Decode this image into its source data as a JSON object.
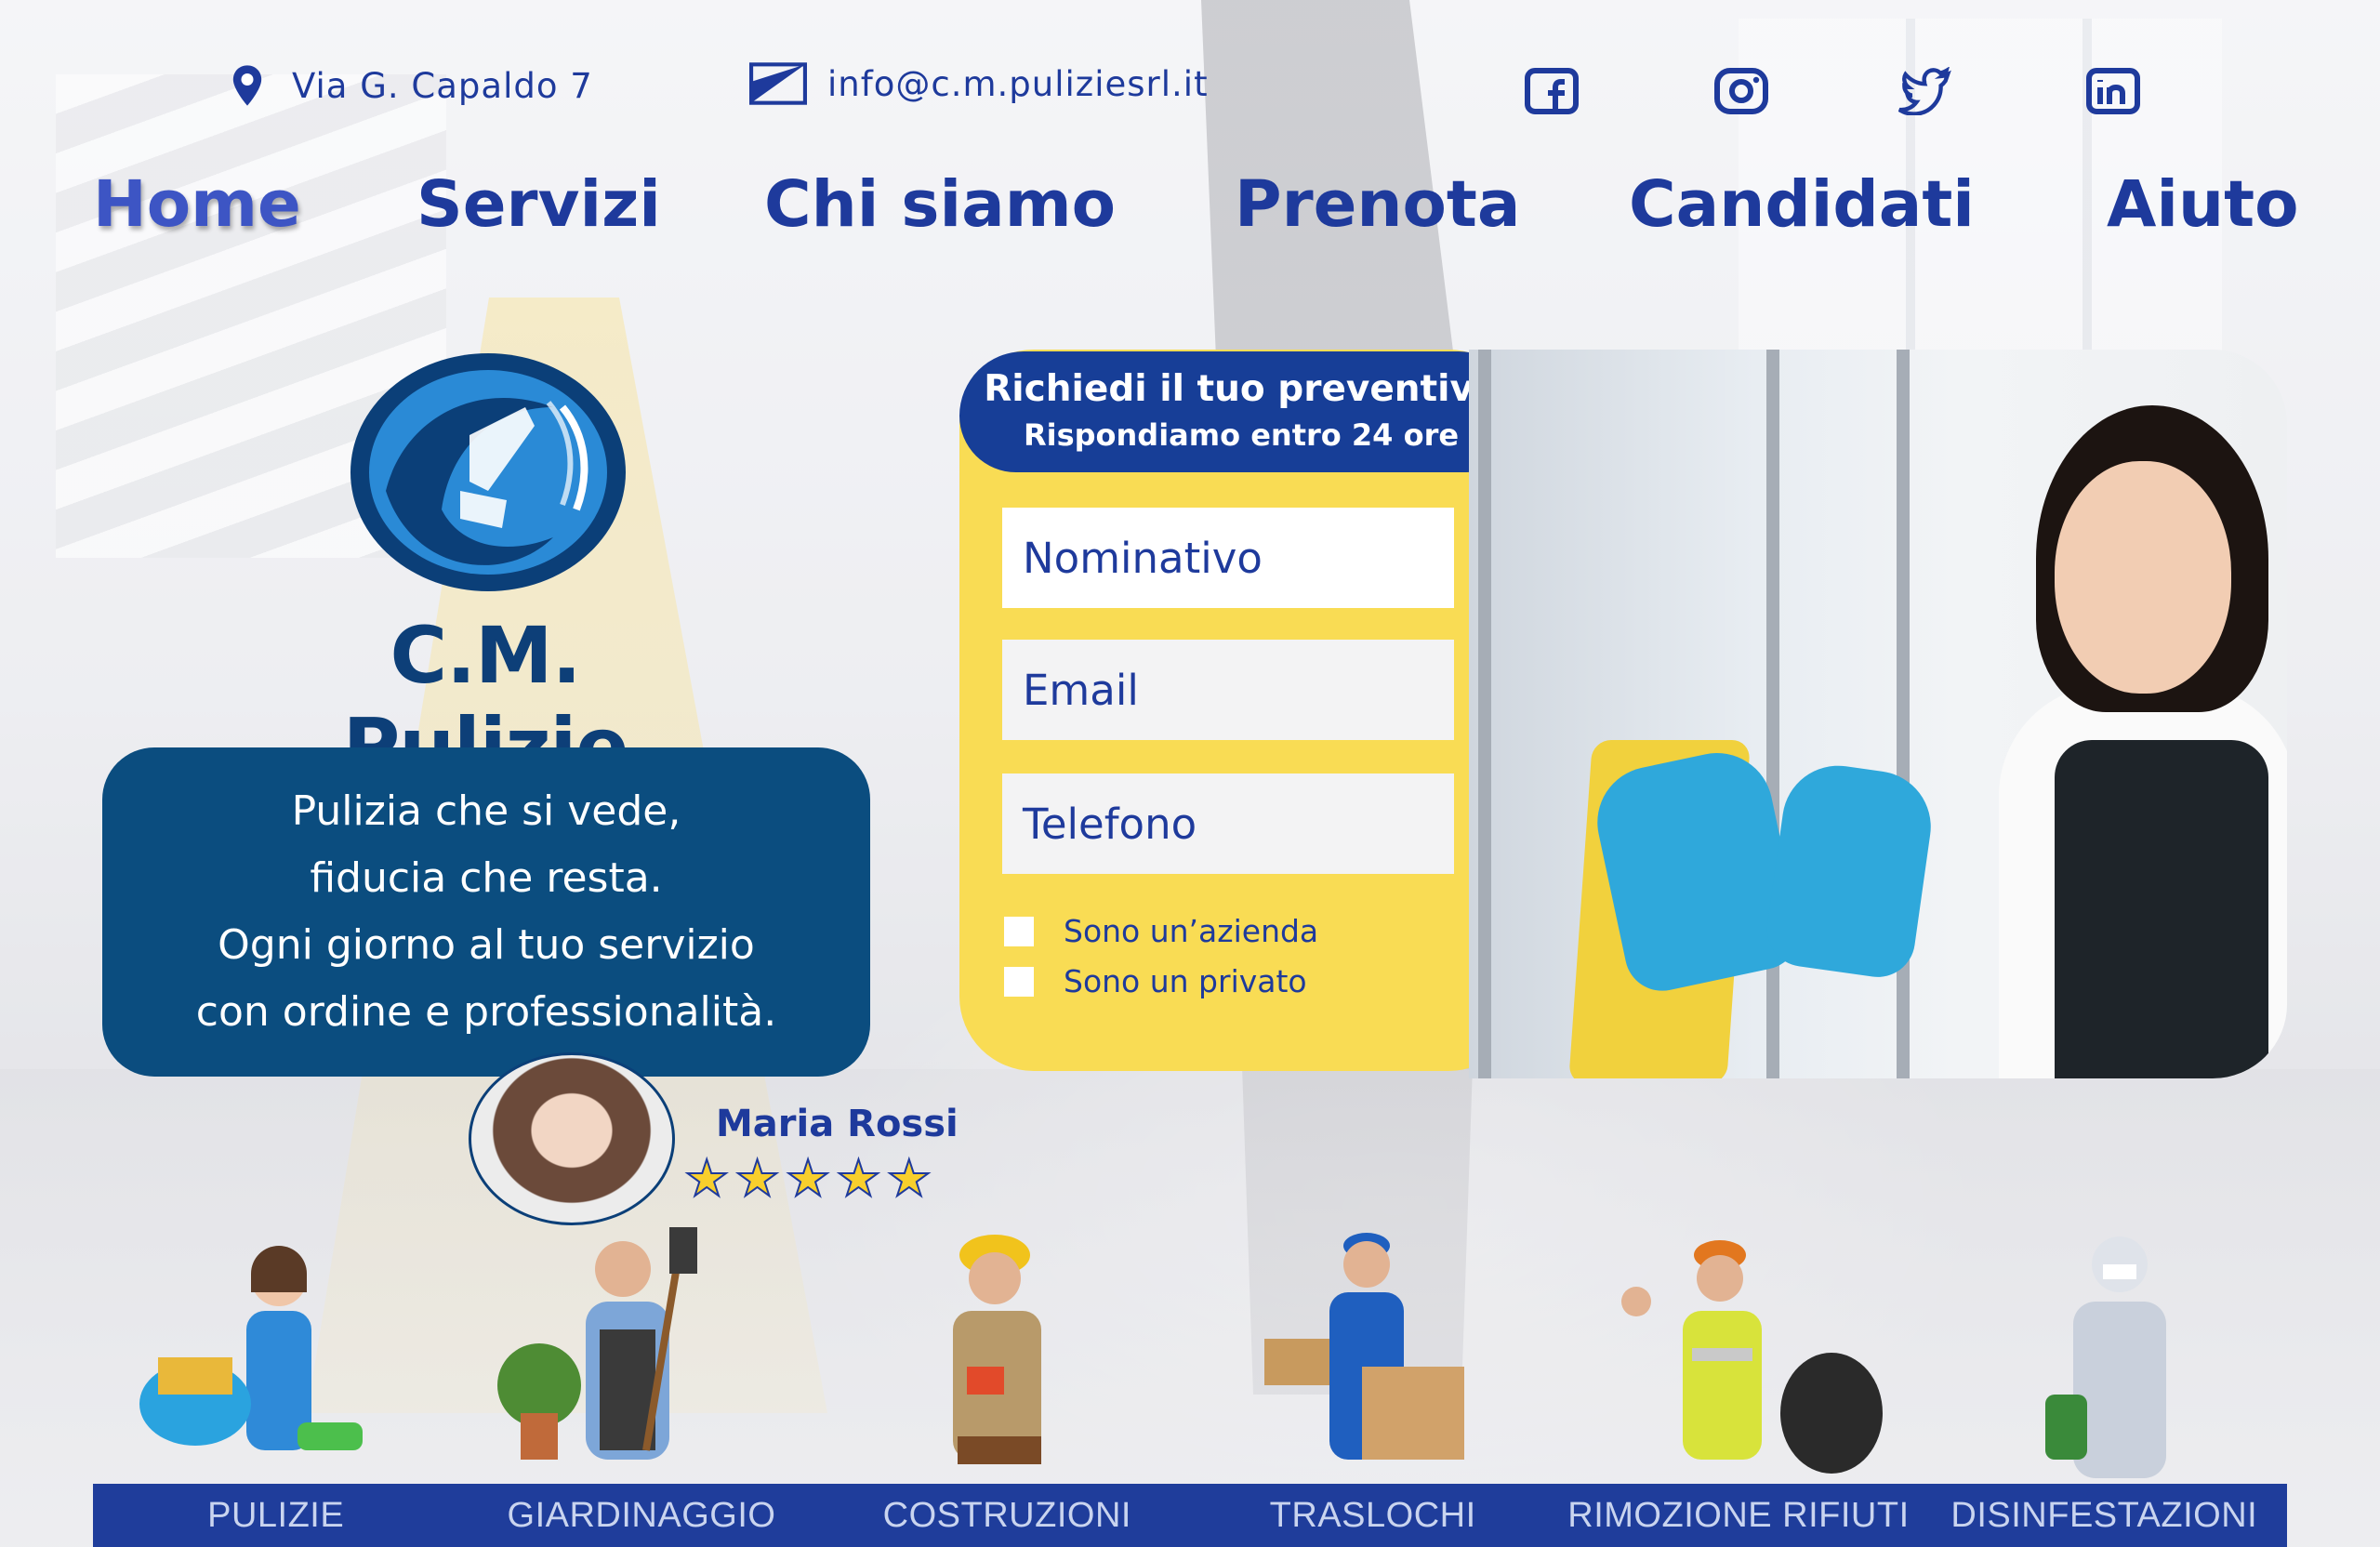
{
  "contact": {
    "address": "Via G. Capaldo 7",
    "email": "info@c.m.puliziesrl.it"
  },
  "social": [
    "facebook-icon",
    "instagram-icon",
    "twitter-icon",
    "linkedin-icon"
  ],
  "nav": {
    "items": [
      "Home",
      "Servizi",
      "Chi siamo",
      "Prenota",
      "Candidati",
      "Aiuto"
    ]
  },
  "brand": {
    "name": "C.M. Pulizie",
    "tagline": [
      "Pulizia che si vede,",
      "fiducia che resta.",
      "Ogni giorno al tuo servizio",
      "con ordine e professionalità."
    ]
  },
  "review": {
    "name": "Maria Rossi",
    "stars": "★★★★★",
    "rating": 5
  },
  "form": {
    "title": "Richiedi il tuo preventivo",
    "subtitle": "Rispondiamo entro 24 ore",
    "fields": [
      "Nominativo",
      "Email",
      "Telefono"
    ],
    "checkboxes": [
      "Sono un’azienda",
      "Sono un privato"
    ]
  },
  "services": [
    "PULIZIE",
    "GIARDINAGGIO",
    "COSTRUZIONI",
    "TRASLOCHI",
    "RIMOZIONE RIFIUTI",
    "DISINFESTAZIONI"
  ],
  "colors": {
    "primary": "#1e3a9c",
    "brand_dark": "#0b4d7f",
    "form_yellow": "#f9dc54",
    "star": "#f8cf2c"
  }
}
